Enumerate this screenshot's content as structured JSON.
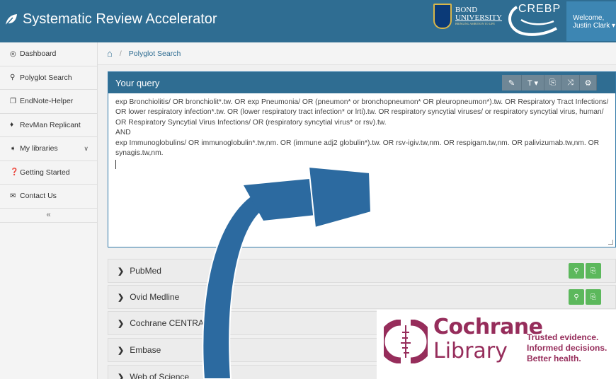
{
  "app": {
    "title": "Systematic Review Accelerator"
  },
  "header": {
    "bond_name": "BOND",
    "bond_sub": "UNIVERSITY",
    "bond_tagline": "BRINGING AMBITION TO LIFE",
    "crebp": "CREBP",
    "welcome": "Welcome,",
    "user": "Justin Clark"
  },
  "sidebar": {
    "items": [
      {
        "label": "Dashboard",
        "icon": "dashboard-icon"
      },
      {
        "label": "Polyglot Search",
        "icon": "search-icon"
      },
      {
        "label": "EndNote-Helper",
        "icon": "clone-icon"
      },
      {
        "label": "RevMan Replicant",
        "icon": "pin-icon"
      },
      {
        "label": "My libraries",
        "icon": "tags-icon"
      },
      {
        "label": "Getting Started",
        "icon": "question-icon"
      },
      {
        "label": "Contact Us",
        "icon": "envelope-icon"
      }
    ],
    "collapse": "«"
  },
  "breadcrumb": {
    "sep": "/",
    "current": "Polyglot Search"
  },
  "query": {
    "title": "Your query",
    "lines": [
      "exp Bronchiolitis/ OR bronchiolit*.tw. OR exp Pneumonia/ OR (pneumon* or bronchopneumon* OR pleuropneumon*).tw. OR Respiratory Tract Infections/",
      "OR lower respiratory infection*.tw. OR (lower respiratory tract infection* or lrti).tw. OR respiratory syncytial viruses/ or respiratory syncytial virus, human/",
      "OR Respiratory Syncytial Virus Infections/ OR (respiratory syncytial virus* or rsv).tw.",
      "AND",
      "exp Immunoglobulins/ OR immunoglobulin*.tw,nm. OR (immune adj2 globulin*).tw. OR rsv-igiv.tw,nm. OR respigam.tw,nm. OR palivizumab.tw,nm. OR",
      "synagis.tw,nm."
    ]
  },
  "databases": [
    {
      "name": "PubMed"
    },
    {
      "name": "Ovid Medline"
    },
    {
      "name": "Cochrane CENTRAL"
    },
    {
      "name": "Embase"
    },
    {
      "name": "Web of Science"
    }
  ],
  "cochrane": {
    "name": "Cochrane",
    "sub": "Library",
    "tag1": "Trusted evidence.",
    "tag2": "Informed decisions.",
    "tag3": "Better health."
  },
  "colors": {
    "header": "#2f6d92",
    "green": "#5cb85c",
    "cochrane": "#962d5b",
    "arrow": "#2c6aa0"
  }
}
